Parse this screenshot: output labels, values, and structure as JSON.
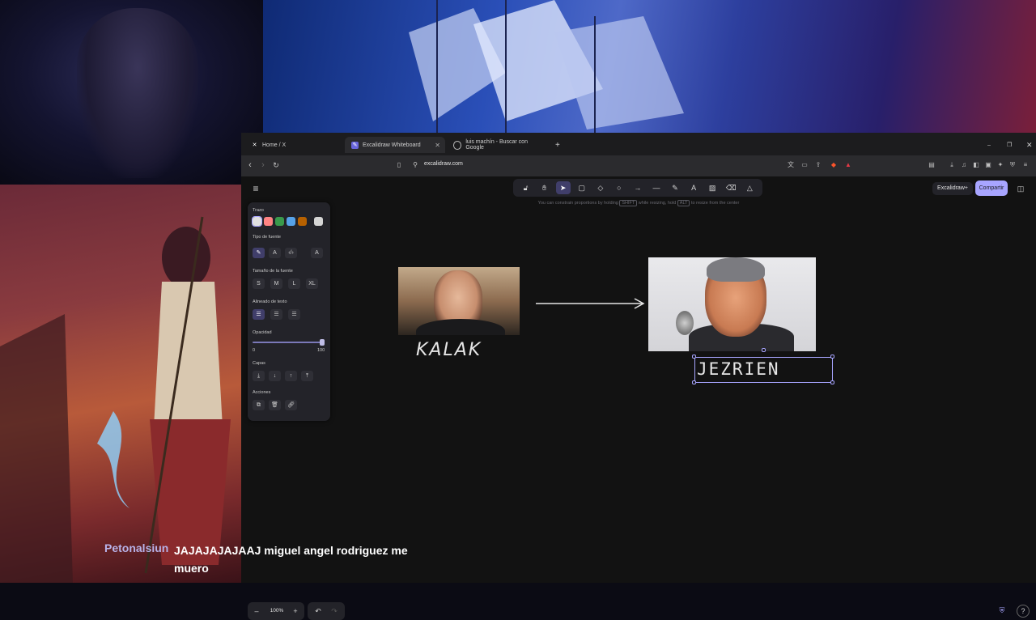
{
  "browser": {
    "tabs": [
      {
        "label": "Home / X",
        "icon": "x-logo-icon"
      },
      {
        "label": "Excalidraw Whiteboard",
        "icon": "excalidraw-icon",
        "active": true
      },
      {
        "label": "luis machín - Buscar con Google",
        "icon": "google-icon"
      }
    ],
    "url": "excalidraw.com"
  },
  "excalidraw": {
    "hint_text": {
      "part1": "You can constrain proportions by holding",
      "key1": "SHIFT",
      "part2": "while resizing, hold",
      "key2": "ALT",
      "part3": "to resize from the center"
    },
    "library_label": "Excalidraw+",
    "share_label": "Compartir",
    "properties": {
      "stroke_label": "Trazo",
      "stroke_colors": [
        "#e0e0e0",
        "#ff8383",
        "#3a994c",
        "#56a2e8",
        "#b76100"
      ],
      "stroke_selected": "#d4d4d4",
      "font_family_label": "Tipo de fuente",
      "font_size_label": "Tamaño de la fuente",
      "font_sizes": [
        "S",
        "M",
        "L",
        "XL"
      ],
      "text_align_label": "Alineado de texto",
      "opacity_label": "Opacidad",
      "opacity_min": "0",
      "opacity_max": "100",
      "layers_label": "Capas",
      "actions_label": "Acciones"
    },
    "canvas": {
      "left_label": "KALAK",
      "right_label": "JEZRIEN"
    },
    "zoom": "100%"
  },
  "chat": {
    "username": "Petonalsiun",
    "message": "JAJAJAJAJAAJ miguel angel rodriguez me muero"
  }
}
